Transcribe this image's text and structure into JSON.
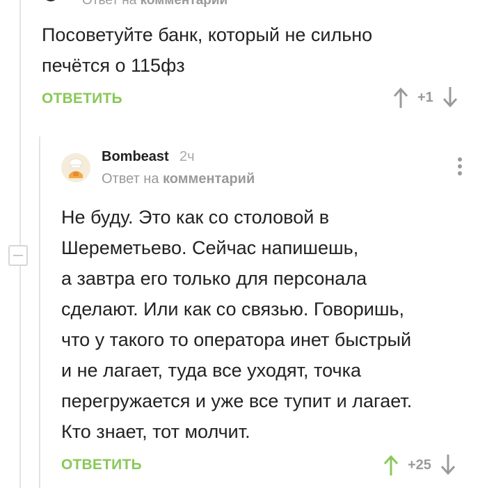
{
  "parent_comment": {
    "reply_prefix": "Ответ на",
    "reply_target": "комментарий",
    "text": "Посоветуйте банк, который не сильно\nпечётся о 115фз",
    "reply_label": "ОТВЕТИТЬ",
    "score": "+1"
  },
  "comment": {
    "username": "Bombeast",
    "time": "2ч",
    "reply_prefix": "Ответ на",
    "reply_target": "комментарий",
    "text": "Не буду. Это как со столовой в\nШереметьево. Сейчас напишешь,\nа завтра его только для персонала\nсделают. Или как со связью. Говоришь,\nчто у такого то оператора инет быстрый\nи не лагает, туда все уходят, точка\nперегружается и уже все тупит и лагает.\nКто знает, тот молчит.",
    "reply_label": "ОТВЕТИТЬ",
    "score": "+25",
    "upvoted": true
  },
  "colors": {
    "accent_green": "#8ac858",
    "muted_gray": "#9a9a9a",
    "thread_line": "#e3e3e3"
  },
  "icons": {
    "upvote": "arrow-up-icon",
    "downvote": "arrow-down-icon",
    "more": "more-vertical-icon",
    "collapse": "minus-icon"
  }
}
